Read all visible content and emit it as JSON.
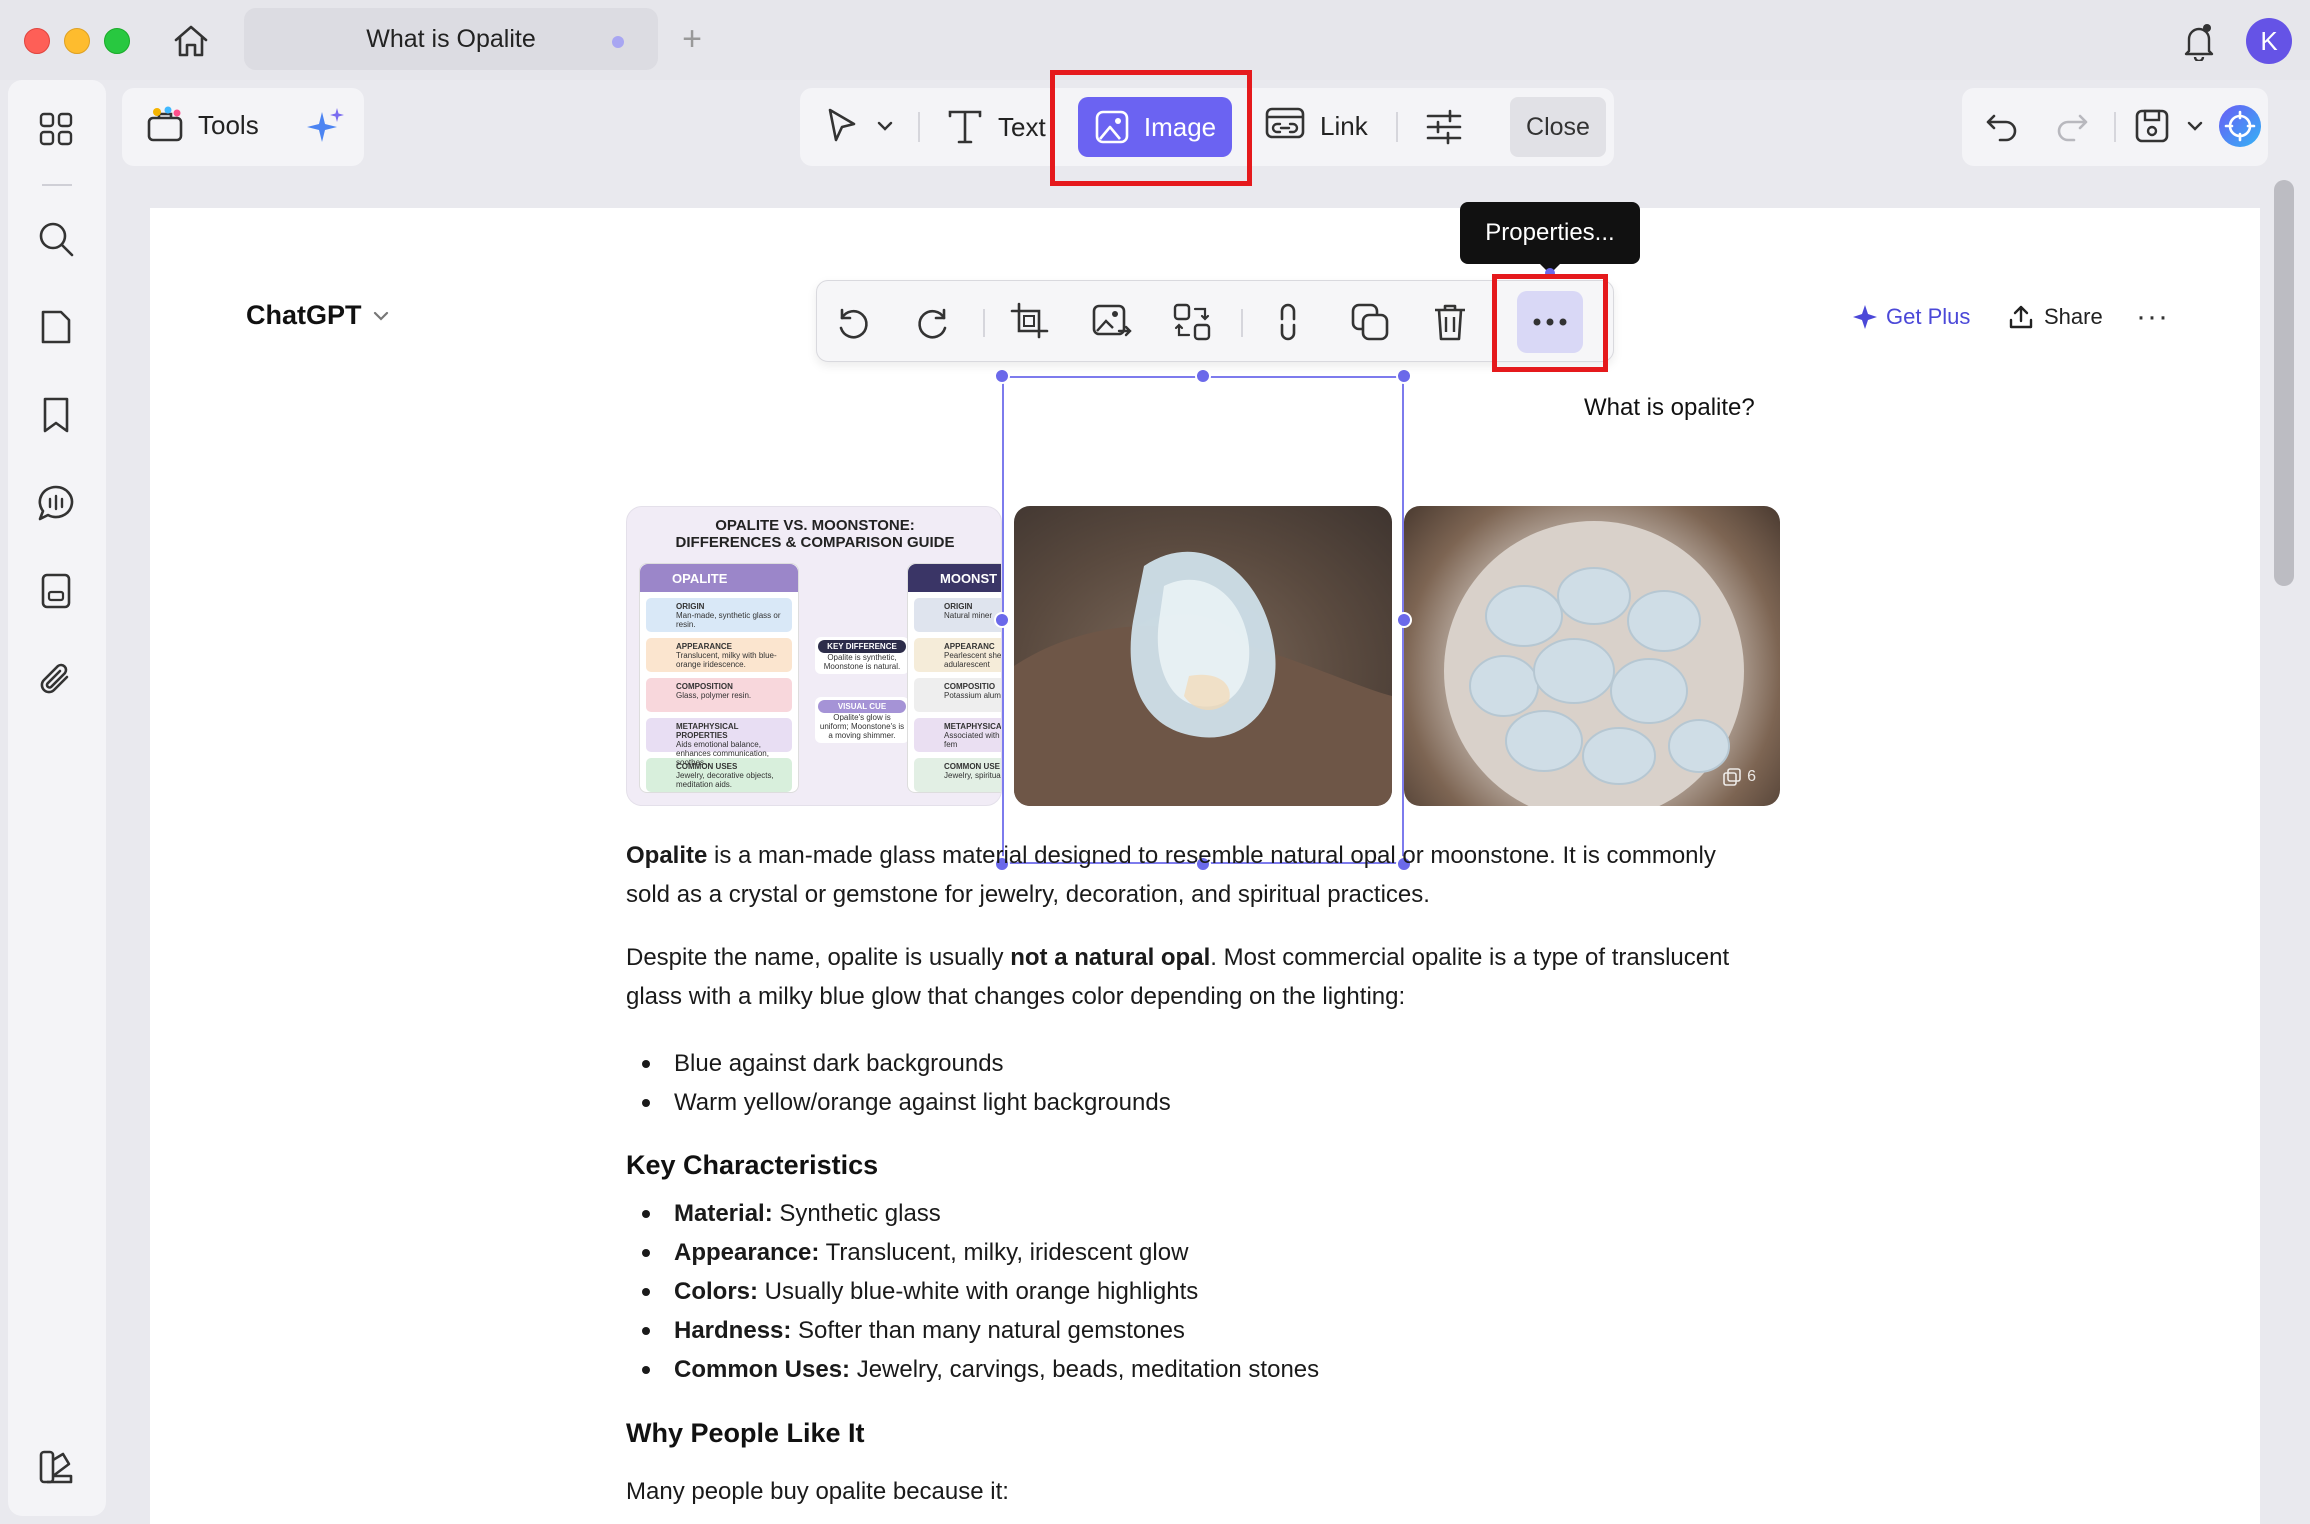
{
  "window": {
    "tab_title": "What is Opalite",
    "tab_add": "+",
    "avatar_letter": "K"
  },
  "toolbar": {
    "tools_label": "Tools",
    "text_label": "Text",
    "image_label": "Image",
    "link_label": "Link",
    "close_label": "Close"
  },
  "tooltip": {
    "label": "Properties..."
  },
  "document": {
    "chat_title": "ChatGPT",
    "get_plus": "Get Plus",
    "share": "Share",
    "more": "···",
    "question": "What is opalite?",
    "para1_bold": "Opalite",
    "para1_rest": " is a man-made glass material designed to resemble natural opal or moonstone. It is commonly sold as a crystal or gemstone for jewelry, decoration, and spiritual practices.",
    "para2_start": "Despite the name, opalite is usually ",
    "para2_bold": "not a natural opal",
    "para2_end": ". Most commercial opalite is a type of translucent glass with a milky blue glow that changes color depending on the lighting:",
    "list1": [
      "Blue against dark backgrounds",
      "Warm yellow/orange against light backgrounds"
    ],
    "heading_key": "Key Characteristics",
    "characteristics": [
      {
        "label": "Material:",
        "value": " Synthetic glass"
      },
      {
        "label": "Appearance:",
        "value": " Translucent, milky, iridescent glow"
      },
      {
        "label": "Colors:",
        "value": " Usually blue-white with orange highlights"
      },
      {
        "label": "Hardness:",
        "value": " Softer than many natural gemstones"
      },
      {
        "label": "Common Uses:",
        "value": " Jewelry, carvings, beads, meditation stones"
      }
    ],
    "heading_why": "Why People Like It",
    "para3": "Many people buy opalite because it:"
  },
  "infographic": {
    "title_line1": "OPALITE VS. MOONSTONE:",
    "title_line2": "DIFFERENCES & COMPARISON GUIDE",
    "left_head": "OPALITE",
    "right_head": "MOONST",
    "left_rows": [
      {
        "t": "ORIGIN",
        "d": "Man-made, synthetic glass or resin."
      },
      {
        "t": "APPEARANCE",
        "d": "Translucent, milky with blue-orange iridescence."
      },
      {
        "t": "COMPOSITION",
        "d": "Glass, polymer resin."
      },
      {
        "t": "METAPHYSICAL PROPERTIES",
        "d": "Aids emotional balance, enhances communication, soothes."
      },
      {
        "t": "COMMON USES",
        "d": "Jewelry, decorative objects, meditation aids."
      }
    ],
    "right_rows": [
      {
        "t": "ORIGIN",
        "d": "Natural miner"
      },
      {
        "t": "APPEARANC",
        "d": "Pearlescent she or adularescent"
      },
      {
        "t": "COMPOSITIO",
        "d": "Potassium alum"
      },
      {
        "t": "METAPHYSICA",
        "d": "Associated with beginnings, fem"
      },
      {
        "t": "COMMON USE",
        "d": "Jewelry, spiritua healing tools."
      }
    ],
    "key_diff_title": "KEY DIFFERENCE",
    "key_diff_text": "Opalite is synthetic, Moonstone is natural.",
    "visual_cue_title": "VISUAL CUE",
    "visual_cue_text": "Opalite's glow is uniform; Moonstone's is a moving shimmer."
  },
  "image3_badge": "6",
  "colors": {
    "accent": "#6b63f2",
    "highlight_box": "#e5191c",
    "selection": "#7d7bed"
  }
}
